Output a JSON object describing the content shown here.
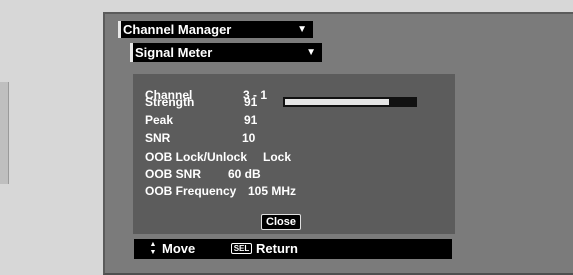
{
  "dropdowns": {
    "menu": {
      "label": "Channel Manager",
      "arrow": "▼"
    },
    "submenu": {
      "label": "Signal Meter",
      "arrow": "▼"
    }
  },
  "signal": {
    "channel": {
      "label": "Channel",
      "value": "3 - 1"
    },
    "strength": {
      "label": "Strength",
      "value": "91"
    },
    "peak": {
      "label": "Peak",
      "value": "91"
    },
    "snr": {
      "label": "SNR",
      "value": "10"
    },
    "oob_lock": {
      "label": "OOB Lock/Unlock",
      "value": "Lock"
    },
    "oob_snr": {
      "label": "OOB SNR",
      "value": "60 dB"
    },
    "oob_frequency": {
      "label": "OOB Frequency",
      "value": "105 MHz"
    }
  },
  "strength_meter": {
    "level_percent": 91
  },
  "buttons": {
    "close_label": "Close"
  },
  "hints": {
    "move_icon": "updown-arrows-icon",
    "move_glyph_up": "▲",
    "move_glyph_down": "▼",
    "move_label": "Move",
    "sel_icon_text": "SEL",
    "return_label": "Return"
  }
}
